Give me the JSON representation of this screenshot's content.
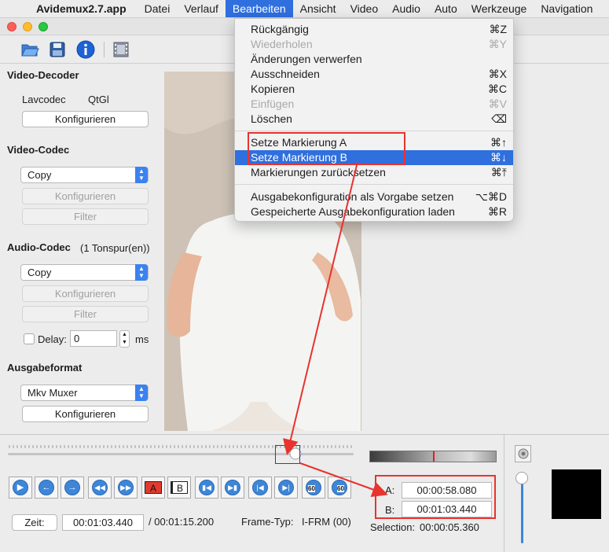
{
  "menubar": {
    "app_name": "Avidemux2.7.app",
    "items": [
      "Datei",
      "Verlauf",
      "Bearbeiten",
      "Ansicht",
      "Video",
      "Audio",
      "Auto",
      "Werkzeuge",
      "Navigation"
    ]
  },
  "edit_menu": {
    "items": [
      {
        "label": "Rückgängig",
        "shortcut": "⌘Z"
      },
      {
        "label": "Wiederholen",
        "shortcut": "⌘Y"
      },
      {
        "label": "Änderungen verwerfen",
        "shortcut": ""
      },
      {
        "label": "Ausschneiden",
        "shortcut": "⌘X"
      },
      {
        "label": "Kopieren",
        "shortcut": "⌘C"
      },
      {
        "label": "Einfügen",
        "shortcut": "⌘V"
      },
      {
        "label": "Löschen",
        "shortcut": "⌫"
      },
      {
        "label": "Setze Markierung A",
        "shortcut": "⌘↑"
      },
      {
        "label": "Setze Markierung B",
        "shortcut": "⌘↓"
      },
      {
        "label": "Markierungen zurücksetzen",
        "shortcut": "⌘⤒"
      },
      {
        "label": "Ausgabekonfiguration als Vorgabe setzen",
        "shortcut": "⌥⌘D"
      },
      {
        "label": "Gespeicherte Ausgabekonfiguration laden",
        "shortcut": "⌘R"
      }
    ]
  },
  "left_panel": {
    "video_decoder": {
      "title": "Video-Decoder",
      "decoders": [
        "Lavcodec",
        "QtGl"
      ],
      "configure": "Konfigurieren"
    },
    "video_codec": {
      "title": "Video-Codec",
      "selected": "Copy",
      "configure": "Konfigurieren",
      "filter": "Filter"
    },
    "audio_codec": {
      "title": "Audio-Codec",
      "tracks": "(1 Tonspur(en))",
      "selected": "Copy",
      "configure": "Konfigurieren",
      "filter": "Filter",
      "delay_label": "Delay:",
      "delay_value": "0",
      "delay_unit": "ms"
    },
    "output_format": {
      "title": "Ausgabeformat",
      "selected": "Mkv Muxer",
      "configure": "Konfigurieren"
    }
  },
  "controls": {
    "frame_buttons": [
      "A",
      "B"
    ],
    "time_label": "Zeit:",
    "current_time": "00:01:03.440",
    "total_time": "/ 00:01:15.200",
    "frame_type_label": "Frame-Typ:",
    "frame_type": "I-FRM (00)",
    "jump_60": "60",
    "marker_a_label": "A:",
    "marker_a": "00:00:58.080",
    "marker_b_label": "B:",
    "marker_b": "00:01:03.440",
    "selection_label": "Selection:",
    "selection": "00:00:05.360"
  },
  "colors": {
    "accent": "#2f6fde",
    "annotation": "#e8332f"
  }
}
